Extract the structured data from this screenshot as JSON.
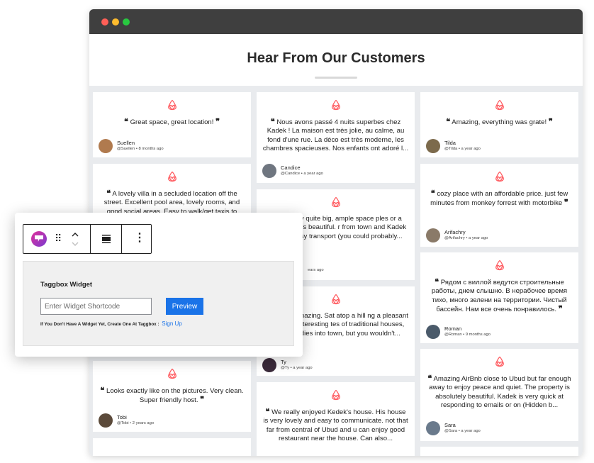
{
  "colors": {
    "titlebar": "#3f3f3f",
    "airbnb": "#ff5a5f",
    "preview_button": "#1a73e8",
    "wall": "#e9ebee"
  },
  "page": {
    "title": "Hear From Our Customers"
  },
  "reviews": [
    {
      "quote": "Great space, great location!",
      "name": "Suellen",
      "meta": "@Suellen • 8 months ago"
    },
    {
      "quote": "A lovely villa in a secluded location off the street. Excellent pool area, lovely rooms, and good social areas. Easy to walk/get taxis to",
      "name": "",
      "meta": ""
    },
    {
      "quote": "Looks exactly like on the pictures. Very clean. Super friendly host.",
      "name": "Tobi",
      "meta": "@Tobi • 2 years ago"
    },
    {
      "quote": "Nous avons passé 4 nuits superbes chez Kadek ! La maison est très jolie, au calme, au fond d'une rue. La déco est très moderne, les chambres spacieuses. Nos enfants ont adoré l...",
      "name": "Candice",
      "meta": "@Candice • a year ago"
    },
    {
      "quote": "villa. Really quite big, ample space ples or a family. Pool is beautiful. r from town and Kadek provides asy transport (you could probably...",
      "name": "",
      "meta": "ears ago"
    },
    {
      "quote": "illa is truly amazing. Sat atop a hill ng a pleasant walk past interesting tes of traditional houses, temples ddies into town, but you wouldn't...",
      "name": "Ty",
      "meta": "@Ty • a year ago"
    },
    {
      "quote": "We really enjoyed Kedek's house. His house is very lovely and easy to communicate. not that far from central of Ubud and u can enjoy good restaurant near the house. Can also...",
      "name": "",
      "meta": ""
    },
    {
      "quote": "Amazing, everything was grate!",
      "name": "Tilda",
      "meta": "@Tilda • a year ago"
    },
    {
      "quote": "cozy place with an affordable price. just few minutes from monkey forrest with motorbike",
      "name": "Arifachry",
      "meta": "@Arifachry • a year ago"
    },
    {
      "quote": "Рядом с виллой ведутся строительные работы, днем слышно. В нерабочее время тихо, много зелени на территории. Чистый бассейн. Нам все очень понравилось.",
      "name": "Roman",
      "meta": "@Roman • 9 months ago"
    },
    {
      "quote": "Amazing AirBnb close to Ubud but far enough away to enjoy peace and quiet. The property is absolutely beautiful. Kadek is very quick at responding to emails or on (Hidden b...",
      "name": "Sara",
      "meta": "@Sara • a year ago"
    }
  ],
  "widget": {
    "title": "Taggbox Widget",
    "input_placeholder": "Enter Widget Shortcode",
    "preview_label": "Preview",
    "hint": "If You Don't Have A Widget Yet, Create One At Taggbox :",
    "signup_label": "Sign Up"
  }
}
